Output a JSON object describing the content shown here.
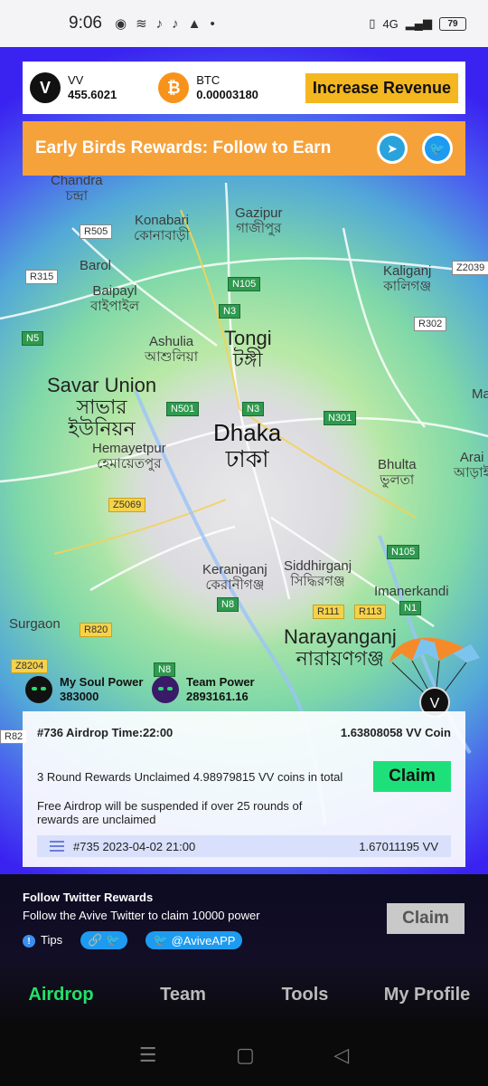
{
  "status_bar": {
    "time": "9:06",
    "network": "4G",
    "battery": "79"
  },
  "top_bar": {
    "vv": {
      "name": "VV",
      "value": "455.6021"
    },
    "btc": {
      "name": "BTC",
      "value": "0.00003180"
    },
    "increase_label": "Increase Revenue"
  },
  "early_birds": {
    "text": "Early Birds Rewards: Follow to Earn"
  },
  "map": {
    "labels": [
      "Chandra",
      "চন্দ্রা",
      "Konabari",
      "কোনাবাড়ী",
      "Gazipur",
      "গাজীপুর",
      "Kaliganj",
      "কালিগঞ্জ",
      "Barol",
      "Baipayl",
      "বাইপাইল",
      "Ashulia",
      "আশুলিয়া",
      "Tongi",
      "টঙ্গী",
      "Savar Union",
      "সাভার",
      "ইউনিয়ন",
      "Dhaka",
      "ঢাকা",
      "Hemayetpur",
      "হেমায়েতপুর",
      "Bhulta",
      "ভুলতা",
      "Arai",
      "আড়াই",
      "Keraniganj",
      "কেরানীগঞ্জ",
      "Siddhirganj",
      "সিদ্ধিরগঞ্জ",
      "Imanerkandi",
      "Surgaon",
      "Narayanganj",
      "নারায়ণগঞ্জ",
      "Ma"
    ],
    "roads": [
      "R505",
      "R315",
      "Z2039",
      "N105",
      "N3",
      "R302",
      "N5",
      "N501",
      "N3",
      "N301",
      "Z5069",
      "N105",
      "N8",
      "R111",
      "R113",
      "N1",
      "R820",
      "Z8204",
      "N8",
      "R82"
    ]
  },
  "power": {
    "soul_label": "My Soul Power",
    "soul_value": "383000",
    "team_label": "Team Power",
    "team_value": "2893161.16"
  },
  "airdrop": {
    "title": "#736 Airdrop Time:22:00",
    "coin": "1.63808058 VV Coin",
    "unclaimed": "3 Round Rewards Unclaimed 4.98979815 VV coins in total",
    "claim_label": "Claim",
    "warning": "Free Airdrop will be suspended if over 25 rounds of rewards are unclaimed",
    "history_label": "#735 2023-04-02 21:00",
    "history_amount": "1.67011195 VV"
  },
  "follow": {
    "title": "Follow Twitter Rewards",
    "desc": "Follow the Avive Twitter to claim 10000 power",
    "tips": "Tips",
    "handle": "@AviveAPP",
    "claim_label": "Claim"
  },
  "nav": {
    "airdrop": "Airdrop",
    "team": "Team",
    "tools": "Tools",
    "profile": "My Profile"
  },
  "colors": {
    "accent": "#25e06a",
    "orange": "#f6a23a",
    "gold": "#f5b71f",
    "twitter": "#1d9bf0",
    "telegram": "#2aa3dc"
  }
}
